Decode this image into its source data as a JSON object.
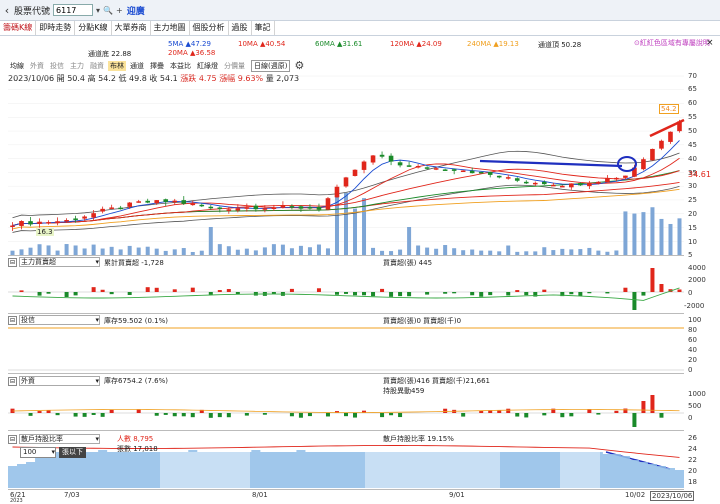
{
  "toolbar": {
    "back_icon": "‹",
    "code_label": "股票代號",
    "code_value": "6117",
    "dropdown_icon": "▾",
    "search_icon": "🔍",
    "plus_label": "+",
    "stock_name": "迎廣"
  },
  "tabs": [
    "籌碼K線",
    "即時走勢",
    "分點K線",
    "大單券商",
    "主力地圖",
    "個股分析",
    "過股",
    "筆記"
  ],
  "ma_legend": {
    "ma5": "5MA ▲47.29",
    "ma10": "10MA ▲40.54",
    "ma60": "60MA ▲31.61",
    "ma120": "120MA ▲24.09",
    "ma240": "240MA ▲19.13",
    "band_top": "通道頂 50.28",
    "band_bottom": "通道底 22.88",
    "ma20": "20MA ▲36.58",
    "link": "⊙紅紅色區域有專屬說明",
    "close_icon": "×"
  },
  "indicator_toolbar": {
    "items": [
      "均線",
      "外資",
      "投信",
      "主力",
      "融資",
      "布林",
      "通道",
      "擇疊",
      "本益比",
      "紅綠燈",
      "分價量"
    ],
    "selected": "布林",
    "period": "日線(週原)",
    "gear_icon": "⚙"
  },
  "ohlc": {
    "date": "2023/10/06",
    "open": "開 50.4",
    "high": "高 54.2",
    "low": "低 49.8",
    "close": "收 54.1",
    "change": "漲跌 4.75",
    "pct": "漲幅 9.63%",
    "volume": "量 2,073"
  },
  "price_axis": [
    "70",
    "65",
    "60",
    "55",
    "50",
    "45",
    "40",
    "35",
    "30",
    "25",
    "20",
    "15",
    "10",
    "5"
  ],
  "price_marks": {
    "high_label": "54.2",
    "right_value": "34.61",
    "low_label": "16.3"
  },
  "panels": {
    "main": {
      "selector": "主力買賣超",
      "line1": "累計買賣超 -1,728",
      "line2": "買賣超(張) 445",
      "axis": [
        "4000",
        "2000",
        "0",
        "-2000"
      ]
    },
    "trust": {
      "selector": "投信",
      "line1": "庫存59.502 (0.1%)",
      "line2": "買賣超(張)0 買賣超(千)0",
      "axis": [
        "100",
        "80",
        "60",
        "40",
        "20",
        "0"
      ]
    },
    "foreign": {
      "selector": "外資",
      "line1": "庫存6754.2 (7.6%)",
      "line2": "買賣超(張)416 買賣超(千)21,661",
      "line3": "持股異動459",
      "axis": [
        "1000",
        "500",
        "0"
      ]
    },
    "holders": {
      "selector": "散戶持股比率",
      "line1": "人數 8,795",
      "line2": "張數 17,018",
      "line3": "散戶持股比率 19.15%",
      "lots_value": "100",
      "lots_suffix": "張以下",
      "axis": [
        "26",
        "24",
        "22",
        "20",
        "18"
      ]
    }
  },
  "x_axis": [
    "6/21",
    "7/03",
    "8/01",
    "9/01",
    "10/02",
    "2023/10/06"
  ],
  "x_axis_year": "2023",
  "colors": {
    "up": "#e0261b",
    "down": "#1a8a2a",
    "ma5": "#1a4bd1",
    "ma10": "#e0261b",
    "ma60": "#1a8a2a",
    "ma120": "#e0261b",
    "ma240": "#f0a020",
    "annotation": "#1f2fbf"
  }
}
